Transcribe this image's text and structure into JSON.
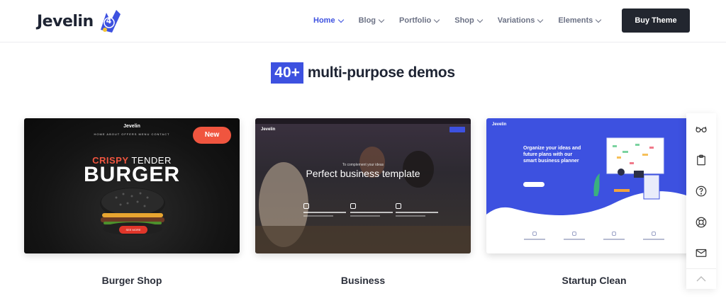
{
  "header": {
    "logo_text": "Jevelin",
    "logo_badge": "4",
    "nav": [
      {
        "label": "Home",
        "active": true
      },
      {
        "label": "Blog",
        "active": false
      },
      {
        "label": "Portfolio",
        "active": false
      },
      {
        "label": "Shop",
        "active": false
      },
      {
        "label": "Variations",
        "active": false
      },
      {
        "label": "Elements",
        "active": false
      }
    ],
    "buy_label": "Buy Theme"
  },
  "section": {
    "highlight": "40+",
    "heading_rest": "multi-purpose demos"
  },
  "demos": [
    {
      "title": "Burger Shop",
      "badge": "New",
      "preview": {
        "logo": "Jevelin",
        "nav": "HOME   ABOUT   OFFERS   MENU   CONTACT",
        "tag_a": "CRISPY",
        "tag_b": "TENDER",
        "headline": "BURGER",
        "cta": "SEE MORE"
      }
    },
    {
      "title": "Business",
      "preview": {
        "logo": "Jevelin",
        "pretitle": "To complement your ideas",
        "headline": "Perfect business template"
      }
    },
    {
      "title": "Startup Clean",
      "preview": {
        "logo": "Jevelin",
        "headline": "Organize your ideas and future plans with our smart business planner"
      }
    }
  ],
  "sidebar_icons": [
    "glasses-icon",
    "clipboard-icon",
    "help-circle-icon",
    "lifebuoy-icon",
    "mail-icon",
    "chevron-up-icon"
  ],
  "colors": {
    "accent": "#3d51e0",
    "dark_button": "#22262f",
    "new_badge": "#f0553f"
  }
}
